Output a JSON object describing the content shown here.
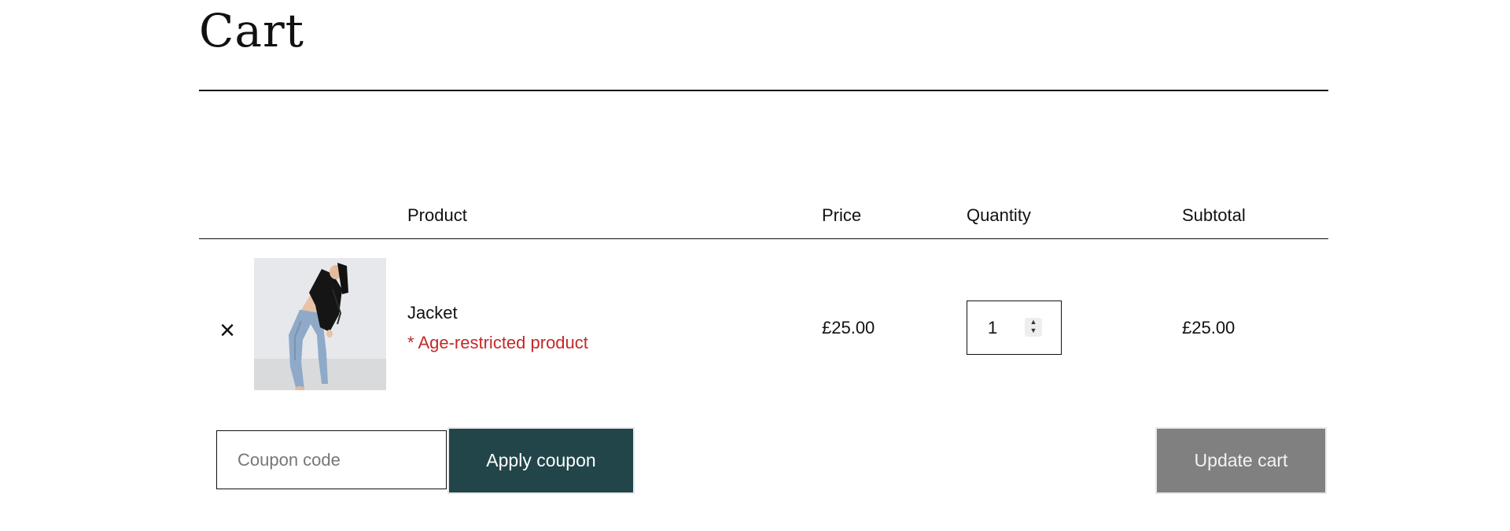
{
  "page": {
    "title": "Cart"
  },
  "table": {
    "headers": {
      "product": "Product",
      "price": "Price",
      "quantity": "Quantity",
      "subtotal": "Subtotal"
    },
    "items": [
      {
        "remove_symbol": "×",
        "name": "Jacket",
        "note": "* Age-restricted product",
        "price": "£25.00",
        "quantity": "1",
        "subtotal": "£25.00"
      }
    ]
  },
  "actions": {
    "coupon_placeholder": "Coupon code",
    "coupon_value": "",
    "apply_coupon_label": "Apply coupon",
    "update_cart_label": "Update cart"
  },
  "icons": {
    "remove": "close-icon",
    "stepper": "spinner-arrows-icon",
    "thumbnail": "product-thumbnail"
  },
  "colors": {
    "text": "#111111",
    "note": "#c62828",
    "apply_button_bg": "#22454a",
    "update_button_bg": "#808080"
  }
}
